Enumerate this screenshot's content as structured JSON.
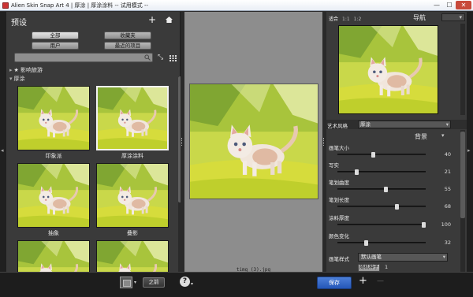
{
  "window": {
    "title": "Alien Skin Snap Art 4 | 厚涂 | 厚涂涂料 -- 试用模式 --",
    "min": "—",
    "max": "☐",
    "close": "✕"
  },
  "presets": {
    "title": "预设",
    "add": "+",
    "filters": [
      "全部",
      "收藏夹",
      "用户",
      "最近的项目"
    ],
    "search_placeholder": "",
    "tree": [
      {
        "arrow": "▸",
        "label": "★ 影响旅游"
      },
      {
        "arrow": "▾",
        "label": "厚涂"
      }
    ],
    "thumbs": [
      {
        "label": "印象派"
      },
      {
        "label": "厚涂涂料"
      },
      {
        "label": "抽象"
      },
      {
        "label": "叠影"
      }
    ]
  },
  "center": {
    "filename": "timg (3).jpg"
  },
  "navigator": {
    "zoom_options": [
      "适合",
      "1:1",
      "1:2"
    ],
    "title": "导航",
    "dropdown": "▾"
  },
  "style": {
    "label": "艺术风格",
    "value": "厚涂"
  },
  "background": {
    "title": "背景",
    "dropdown": "▾",
    "sliders": [
      {
        "label": "画笔大小",
        "value": "40",
        "level": 0.4
      },
      {
        "label": "写实",
        "value": "21",
        "level": 0.21
      },
      {
        "label": "笔划曲度",
        "value": "55",
        "level": 0.55
      },
      {
        "label": "笔划长度",
        "value": "68",
        "level": 0.68
      },
      {
        "label": "涂料厚度",
        "value": "100",
        "level": 1.0
      },
      {
        "label": "颜色变化",
        "value": "32",
        "level": 0.32
      }
    ],
    "pen_label": "画笔样式",
    "pen_value": "默认画笔",
    "seed_button": "随机种子",
    "seed_value": "1"
  },
  "bottom": {
    "before": "之前",
    "help": "?",
    "save": "保存",
    "add": "+",
    "remove": "—"
  },
  "colors": {
    "save_blue": "#2f63c6",
    "panel": "#3a3a3a",
    "grass": "#c9d84a"
  }
}
